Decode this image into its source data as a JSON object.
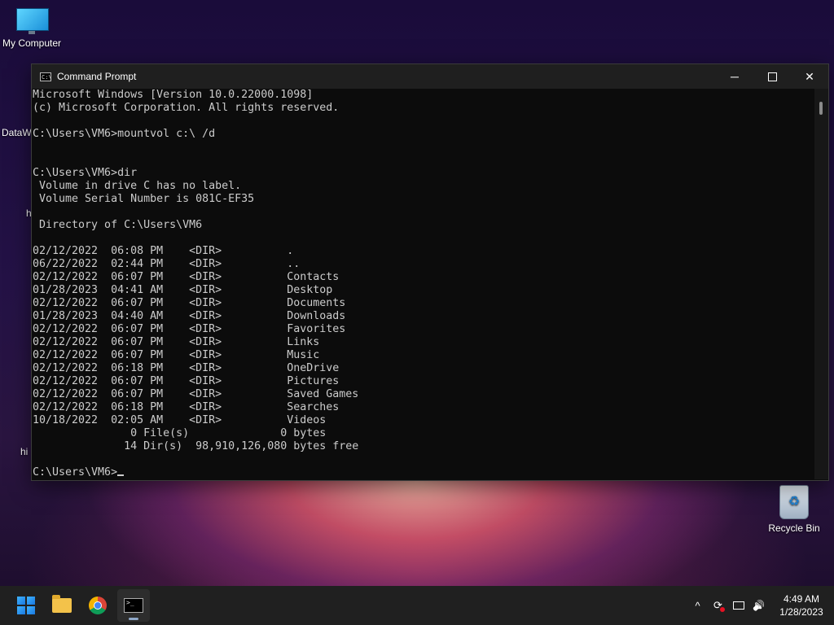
{
  "desktop": {
    "my_computer_label": "My Computer",
    "recycle_bin_label": "Recycle Bin",
    "partial_labels": [
      "DataW",
      "h",
      "hi"
    ]
  },
  "window": {
    "title": "Command Prompt",
    "minimize_glyph": "─",
    "close_glyph": "✕",
    "icon_text": "C:\\"
  },
  "console": {
    "lines": [
      "Microsoft Windows [Version 10.0.22000.1098]",
      "(c) Microsoft Corporation. All rights reserved.",
      "",
      "C:\\Users\\VM6>mountvol c:\\ /d",
      "",
      "",
      "C:\\Users\\VM6>dir",
      " Volume in drive C has no label.",
      " Volume Serial Number is 081C-EF35",
      "",
      " Directory of C:\\Users\\VM6",
      "",
      "02/12/2022  06:08 PM    <DIR>          .",
      "06/22/2022  02:44 PM    <DIR>          ..",
      "02/12/2022  06:07 PM    <DIR>          Contacts",
      "01/28/2023  04:41 AM    <DIR>          Desktop",
      "02/12/2022  06:07 PM    <DIR>          Documents",
      "01/28/2023  04:40 AM    <DIR>          Downloads",
      "02/12/2022  06:07 PM    <DIR>          Favorites",
      "02/12/2022  06:07 PM    <DIR>          Links",
      "02/12/2022  06:07 PM    <DIR>          Music",
      "02/12/2022  06:18 PM    <DIR>          OneDrive",
      "02/12/2022  06:07 PM    <DIR>          Pictures",
      "02/12/2022  06:07 PM    <DIR>          Saved Games",
      "02/12/2022  06:18 PM    <DIR>          Searches",
      "10/18/2022  02:05 AM    <DIR>          Videos",
      "               0 File(s)              0 bytes",
      "              14 Dir(s)  98,910,126,080 bytes free",
      ""
    ],
    "prompt": "C:\\Users\\VM6>"
  },
  "taskbar": {
    "tray_chevron": "^",
    "volume_glyph": "🔊",
    "time": "4:49 AM",
    "date": "1/28/2023"
  }
}
